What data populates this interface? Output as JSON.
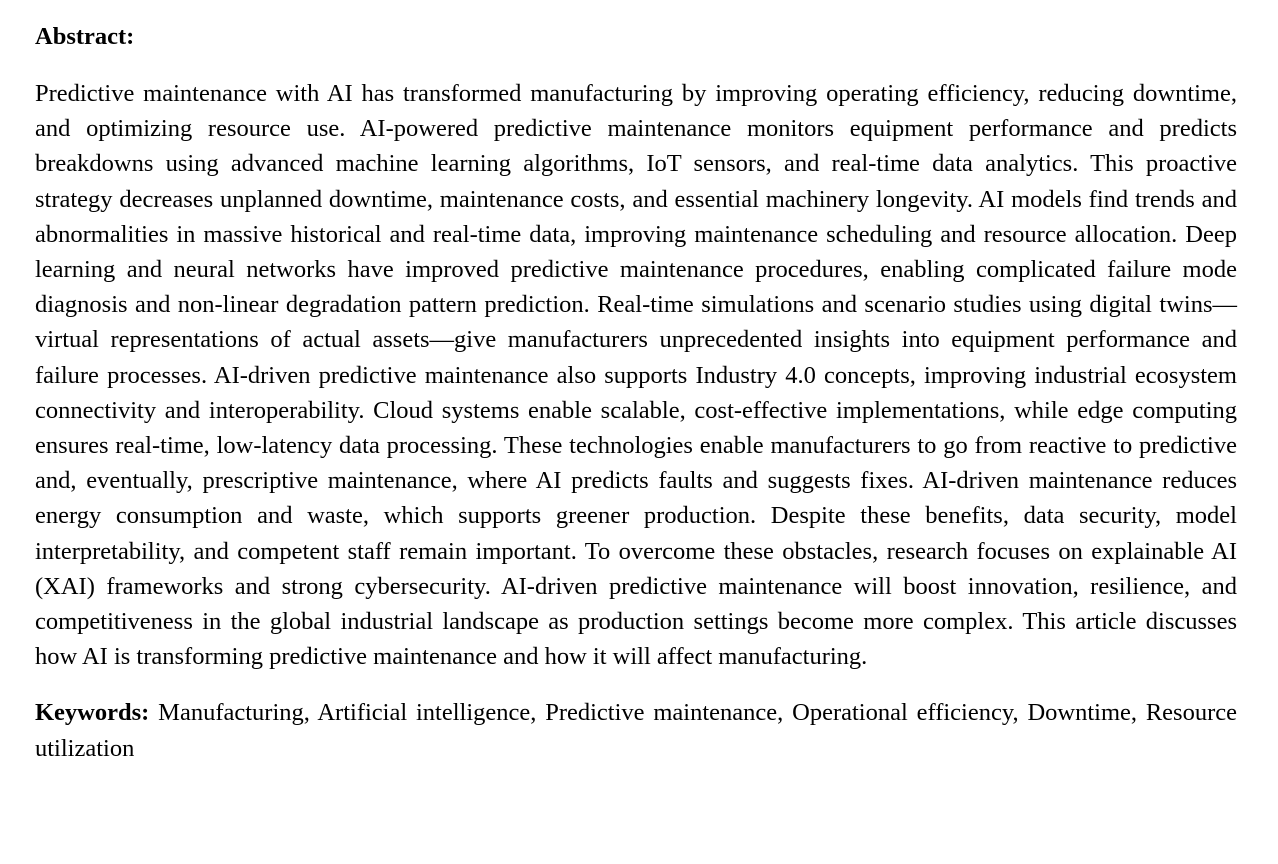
{
  "abstract": {
    "heading": "Abstract:",
    "text": "Predictive maintenance with AI has transformed manufacturing by improving operating efficiency, reducing downtime, and optimizing resource use. AI-powered predictive maintenance monitors equipment performance and predicts breakdowns using advanced machine learning algorithms, IoT sensors, and real-time data analytics. This proactive strategy decreases unplanned downtime, maintenance costs, and essential machinery longevity. AI models find trends and abnormalities in massive historical and real-time data, improving maintenance scheduling and resource allocation. Deep learning and neural networks have improved predictive maintenance procedures, enabling complicated failure mode diagnosis and non-linear degradation pattern prediction. Real-time simulations and scenario studies using digital twins—virtual representations of actual assets—give manufacturers unprecedented insights into equipment performance and failure processes. AI-driven predictive maintenance also supports Industry 4.0 concepts, improving industrial ecosystem connectivity and interoperability. Cloud systems enable scalable, cost-effective implementations, while edge computing ensures real-time, low-latency data processing. These technologies enable manufacturers to go from reactive to predictive and, eventually, prescriptive maintenance, where AI predicts faults and suggests fixes. AI-driven maintenance reduces energy consumption and waste, which supports greener production. Despite these benefits, data security, model interpretability, and competent staff remain important. To overcome these obstacles, research focuses on explainable AI (XAI) frameworks and strong cybersecurity. AI-driven predictive maintenance will boost innovation, resilience, and competitiveness in the global industrial landscape as production settings become more complex. This article discusses how AI is transforming predictive maintenance and how it will affect manufacturing."
  },
  "keywords": {
    "label": "Keywords:",
    "text": " Manufacturing, Artificial intelligence, Predictive maintenance, Operational efficiency, Downtime, Resource utilization"
  }
}
